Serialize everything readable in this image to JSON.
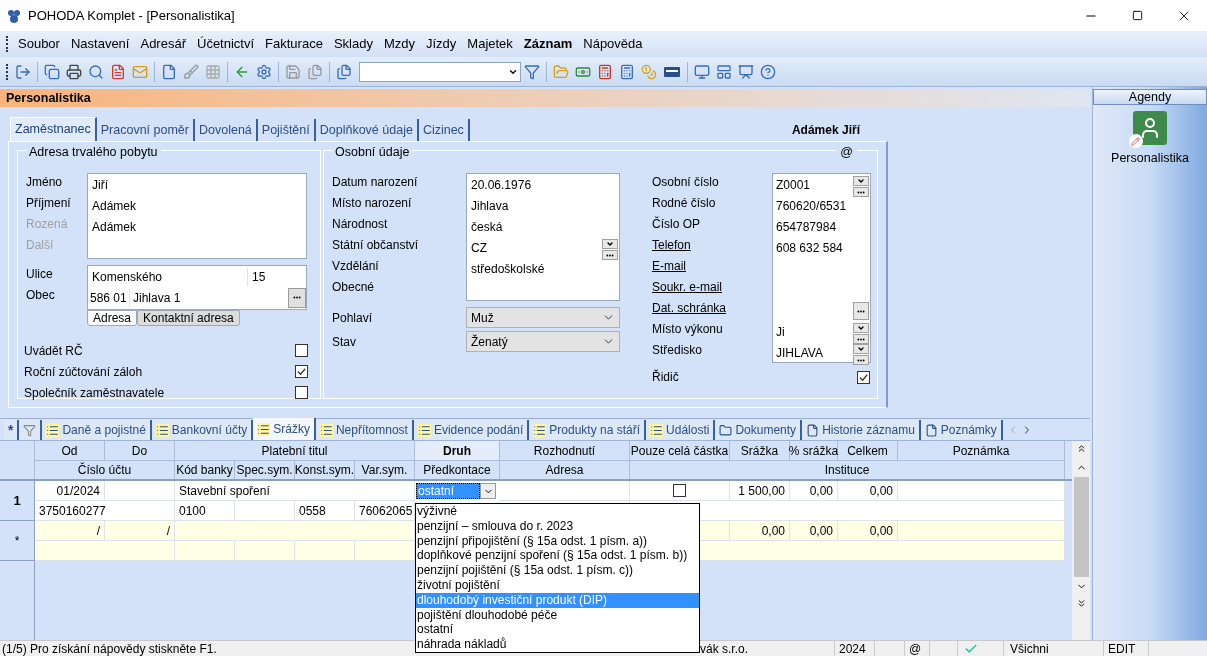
{
  "window": {
    "title": "POHODA Komplet - [Personalistika]"
  },
  "menu": [
    {
      "label": "Soubor",
      "emphasized": false
    },
    {
      "label": "Nastavení",
      "emphasized": false
    },
    {
      "label": "Adresář",
      "emphasized": false
    },
    {
      "label": "Účetnictví",
      "emphasized": false
    },
    {
      "label": "Fakturace",
      "emphasized": false
    },
    {
      "label": "Sklady",
      "emphasized": false
    },
    {
      "label": "Mzdy",
      "emphasized": false
    },
    {
      "label": "Jízdy",
      "emphasized": false
    },
    {
      "label": "Majetek",
      "emphasized": false
    },
    {
      "label": "Záznam",
      "emphasized": true
    },
    {
      "label": "Nápověda",
      "emphasized": false
    }
  ],
  "agenda_header": "Personalistika",
  "record_name": "Adámek Jiří",
  "tabs": [
    {
      "label": "Zaměstnanec",
      "selected": true
    },
    {
      "label": "Pracovní poměr",
      "selected": false
    },
    {
      "label": "Dovolená",
      "selected": false
    },
    {
      "label": "Pojištění",
      "selected": false
    },
    {
      "label": "Doplňkové údaje",
      "selected": false
    },
    {
      "label": "Cizinec",
      "selected": false
    }
  ],
  "address": {
    "title": "Adresa trvalého pobytu",
    "fields": [
      {
        "label": "Jméno",
        "value": "Jiří",
        "disabled": false
      },
      {
        "label": "Příjmení",
        "value": "Adámek",
        "disabled": false
      },
      {
        "label": "Rozená",
        "value": "Adámek",
        "disabled": true
      },
      {
        "label": "Další",
        "disabled": true
      }
    ],
    "street": {
      "label": "Ulice",
      "value": "Komenského",
      "number": "15"
    },
    "city": {
      "label": "Obec",
      "zip": "586 01",
      "value": "Jihlava 1"
    },
    "address_tabs": [
      {
        "label": "Adresa",
        "selected": true
      },
      {
        "label": "Kontaktní adresa",
        "selected": false
      }
    ],
    "checks": [
      {
        "label": "Uvádět RČ",
        "checked": false
      },
      {
        "label": "Roční zúčtování záloh",
        "checked": true
      },
      {
        "label": "Společník zaměstnavatele",
        "checked": false
      }
    ]
  },
  "personal": {
    "title": "Osobní údaje",
    "mark": "@",
    "fields": [
      {
        "label": "Datum narození",
        "value": "20.06.1976",
        "kind": "text"
      },
      {
        "label": "Místo narození",
        "value": "Jihlava",
        "kind": "text"
      },
      {
        "label": "Národnost",
        "value": "česká",
        "kind": "text"
      },
      {
        "label": "Státní občanství",
        "value": "CZ",
        "kind": "combo"
      },
      {
        "label": "Vzdělání",
        "value": "středoškolské",
        "kind": "text"
      },
      {
        "label": "Obecné",
        "kind": "text"
      }
    ],
    "selects": [
      {
        "label": "Pohlaví",
        "value": "Muž"
      },
      {
        "label": "Stav",
        "value": "Ženatý"
      }
    ],
    "ids": [
      {
        "label": "Osobní číslo",
        "value": "Z0001",
        "kind": "combo",
        "link": false
      },
      {
        "label": "Rodné číslo",
        "value": "760620/6531",
        "kind": "text",
        "link": false
      },
      {
        "label": "Číslo OP",
        "value": "654787984",
        "kind": "text",
        "link": false
      },
      {
        "label": "Telefon",
        "value": "608 632 584",
        "kind": "text",
        "link": true
      },
      {
        "label": "E-mail",
        "kind": "text",
        "link": true
      },
      {
        "label": "Soukr. e-mail",
        "kind": "text",
        "link": true
      },
      {
        "label": "Dat. schránka",
        "kind": "ellipsis",
        "link": true
      },
      {
        "label": "Místo výkonu",
        "value": "Ji",
        "kind": "combo",
        "link": false
      },
      {
        "label": "Středisko",
        "value": "JIHLAVA",
        "kind": "combo",
        "link": false
      }
    ],
    "driver": {
      "label": "Řidič",
      "checked": true
    }
  },
  "agendas": {
    "title": "Agendy",
    "items": [
      {
        "label": "Personalistika"
      }
    ]
  },
  "bottom_tabs": [
    {
      "kind": "star",
      "label": "*",
      "selected": false
    },
    {
      "kind": "filter",
      "selected": false
    },
    {
      "kind": "list",
      "label": "Daně a pojistné",
      "selected": false
    },
    {
      "kind": "list",
      "label": "Bankovní účty",
      "selected": false
    },
    {
      "kind": "list",
      "label": "Srážky",
      "selected": true
    },
    {
      "kind": "list",
      "label": "Nepřítomnost",
      "selected": false
    },
    {
      "kind": "list",
      "label": "Evidence podání",
      "selected": false
    },
    {
      "kind": "list",
      "label": "Produkty na stáří",
      "selected": false
    },
    {
      "kind": "list",
      "label": "Události",
      "selected": false
    },
    {
      "kind": "folder",
      "label": "Dokumenty",
      "selected": false
    },
    {
      "kind": "page",
      "label": "Historie záznamu",
      "selected": false
    },
    {
      "kind": "page",
      "label": "Poznámky",
      "selected": false
    }
  ],
  "grid": {
    "header_top": [
      {
        "label": "Od",
        "selected": false
      },
      {
        "label": "Do",
        "selected": false
      },
      {
        "label": "Platební titul",
        "selected": false
      },
      {
        "label": "Druh",
        "selected": true
      },
      {
        "label": "Rozhodnutí",
        "selected": false
      },
      {
        "label": "Pouze celá částka",
        "selected": false
      },
      {
        "label": "Srážka",
        "selected": false
      },
      {
        "label": "% srážka",
        "selected": false
      },
      {
        "label": "Celkem",
        "selected": false
      },
      {
        "label": "Poznámka",
        "selected": false
      }
    ],
    "header_bottom": [
      "Číslo účtu",
      "Kód banky",
      "Spec.sym.",
      "Konst.sym.",
      "Var.sym.",
      "Předkontace",
      "Adresa",
      "Instituce"
    ],
    "rows": [
      {
        "number": "1",
        "new": false,
        "editing": true,
        "from": "01/2024",
        "title": "Stavební spoření",
        "type": "ostatní",
        "whole_amount_only": false,
        "deduction": "1 500,00",
        "percent": "0,00",
        "total": "0,00",
        "account": "3750160277",
        "bank_code": "0100",
        "const_symbol": "0558",
        "var_symbol": "76062065"
      },
      {
        "number": "*",
        "new": true,
        "editing": false,
        "from": "/",
        "to": "/",
        "deduction": "0,00",
        "percent": "0,00",
        "total": "0,00"
      }
    ],
    "dropdown": [
      {
        "label": "výživné",
        "selected": false
      },
      {
        "label": "penzijní – smlouva do r. 2023",
        "selected": false
      },
      {
        "label": "penzijní připojištění (§ 15a odst. 1 písm. a))",
        "selected": false
      },
      {
        "label": "doplňkové penzijní spoření (§ 15a odst. 1 písm. b))",
        "selected": false
      },
      {
        "label": "penzijní pojištění (§ 15a odst. 1 písm. c))",
        "selected": false
      },
      {
        "label": "životní pojištění",
        "selected": false
      },
      {
        "label": "dlouhodobý investiční produkt (DIP)",
        "selected": true
      },
      {
        "label": "pojištění dlouhodobé péče",
        "selected": false
      },
      {
        "label": "ostatní",
        "selected": false
      },
      {
        "label": "náhrada nákladů",
        "selected": false
      }
    ]
  },
  "status_bar": {
    "help": "(1/5) Pro získání nápovědy stiskněte F1.",
    "company": "vák s.r.o.",
    "year": "2024",
    "mail": "@",
    "filter": "Všichni",
    "mode": "EDIT"
  }
}
